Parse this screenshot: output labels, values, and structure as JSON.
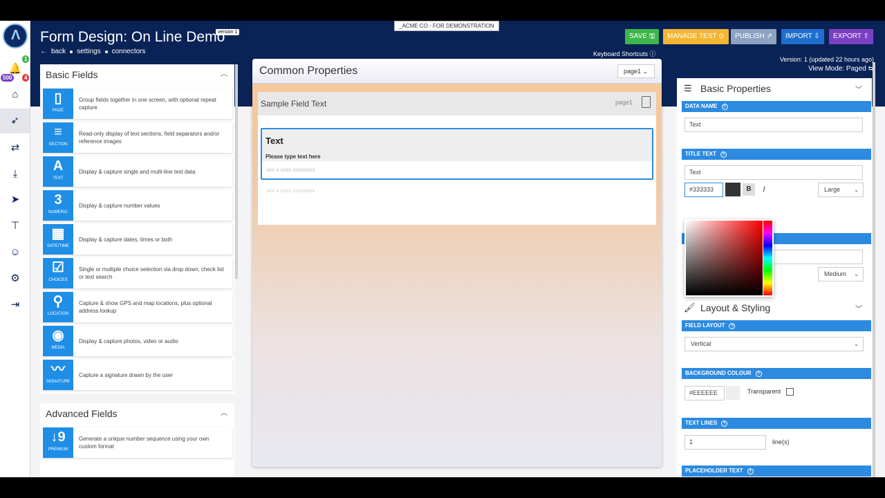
{
  "app": {
    "title": "Form Design: On Line Demo",
    "version_tag": "version 1",
    "demo_banner": "_ACME CO - FOR DEMONSTRATION"
  },
  "breadcrumb": {
    "back": "back",
    "settings": "settings",
    "connectors": "connectors"
  },
  "toolbar": {
    "save": "SAVE",
    "manage_test": "MANAGE TEST",
    "publish": "PUBLISH",
    "import": "IMPORT",
    "export": "EXPORT",
    "keyboard_shortcuts": "Keyboard Shortcuts"
  },
  "version_info": {
    "line1": "Version: 1 (updated 22 hours ago)",
    "view_mode": "View Mode: Paged"
  },
  "rail": {
    "badge_green": "1",
    "badge_purple": "500",
    "badge_red": "4"
  },
  "basic_fields": {
    "title": "Basic Fields",
    "items": [
      {
        "glyph": "▯",
        "label": "PAGE",
        "desc": "Group fields together in one screen, with optional repeat capture"
      },
      {
        "glyph": "≡",
        "label": "SECTION",
        "desc": "Read-only display of text sections, field separators and/or reference images"
      },
      {
        "glyph": "A",
        "label": "TEXT",
        "desc": "Display & capture single and multi-line text data"
      },
      {
        "glyph": "3",
        "label": "NUMERIC",
        "desc": "Display & capture number values"
      },
      {
        "glyph": "▦",
        "label": "DATE/TIME",
        "desc": "Display & capture dates, times or both"
      },
      {
        "glyph": "☑",
        "label": "CHOICES",
        "desc": "Single or multiple choice selection via drop down, check list or text search"
      },
      {
        "glyph": "⚲",
        "label": "LOCATION",
        "desc": "Capture & show GPS and map locations, plus optional address lookup"
      },
      {
        "glyph": "◉",
        "label": "MEDIA",
        "desc": "Display & capture photos, video or audio"
      },
      {
        "glyph": "〰",
        "label": "SIGNATURE",
        "desc": "Capture a signature drawn by the user"
      }
    ]
  },
  "advanced_fields": {
    "title": "Advanced Fields",
    "items": [
      {
        "glyph": "↓9",
        "label": "PREMIUM",
        "desc": "Generate a unique number sequence using your own custom format"
      }
    ]
  },
  "center": {
    "title": "Common Properties",
    "page_select": "page1",
    "sample_title": "Sample Field Text",
    "sample_page": "page1",
    "field_title": "Text",
    "field_prompt": "Please type text here",
    "field_placeholder": "xxx x xxxx xxxxxxxx",
    "placeholder2": "xxx x xxxx xxxxxxxx"
  },
  "right": {
    "basic_properties": "Basic Properties",
    "data_name_label": "DATA NAME",
    "data_name_value": "Text",
    "title_text_label": "TITLE TEXT",
    "title_text_value": "Text",
    "color_value": "#333333",
    "bold": "B",
    "italic": "I",
    "size_large": "Large",
    "size_medium": "Medium",
    "layout_styling": "Layout & Styling",
    "field_layout_label": "FIELD LAYOUT",
    "field_layout_value": "Vertical",
    "bg_colour_label": "BACKGROUND COLOUR",
    "bg_colour_value": "#EEEEEE",
    "transparent": "Transparent",
    "text_lines_label": "TEXT LINES",
    "text_lines_value": "1",
    "lines_unit": "line(s)",
    "placeholder_label": "PLACEHOLDER TEXT"
  },
  "colors": {
    "nav": "#0a2357",
    "accent": "#2c8be0",
    "save": "#3eb54b",
    "manage": "#f4b631",
    "publish": "#8da3c2",
    "import": "#1e6fcf",
    "export": "#7b3fc4"
  }
}
